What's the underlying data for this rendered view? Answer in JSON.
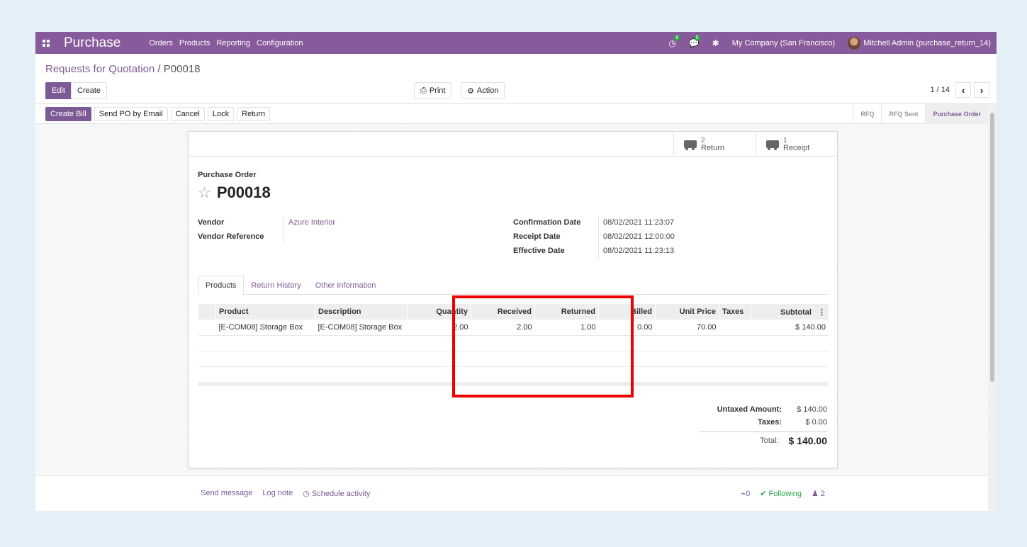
{
  "navbar": {
    "brand": "Purchase",
    "menu": [
      "Orders",
      "Products",
      "Reporting",
      "Configuration"
    ],
    "activity_count": "8",
    "messages_count": "5",
    "company": "My Company (San Francisco)",
    "user": "Mitchell Admin (purchase_return_14)"
  },
  "breadcrumb": {
    "parent": "Requests for Quotation",
    "separator": " / ",
    "current": "P00018"
  },
  "toolbar": {
    "edit": "Edit",
    "create": "Create",
    "print": "Print",
    "action": "Action"
  },
  "pager": {
    "value": "1 / 14"
  },
  "status_buttons": [
    "Create Bill",
    "Send PO by Email",
    "Cancel",
    "Lock",
    "Return"
  ],
  "stages": [
    "RFQ",
    "RFQ Sent",
    "Purchase Order"
  ],
  "active_stage": "Purchase Order",
  "smart_buttons": [
    {
      "count": "2",
      "label": "Return",
      "icon": "truck-icon"
    },
    {
      "count": "1",
      "label": "Receipt",
      "icon": "truck-icon"
    }
  ],
  "form": {
    "type_label": "Purchase Order",
    "name": "P00018",
    "vendor_label": "Vendor",
    "vendor": "Azure Interior",
    "vendor_ref_label": "Vendor Reference",
    "vendor_ref": "",
    "confirmation_label": "Confirmation Date",
    "confirmation": "08/02/2021 11:23:07",
    "receipt_label": "Receipt Date",
    "receipt": "08/02/2021 12:00:00",
    "effective_label": "Effective Date",
    "effective": "08/02/2021 11:23:13"
  },
  "tabs": [
    "Products",
    "Return History",
    "Other Information"
  ],
  "lines": {
    "columns": [
      "Product",
      "Description",
      "Quantity",
      "Received",
      "Returned",
      "Billed",
      "Unit Price",
      "Taxes",
      "Subtotal"
    ],
    "rows": [
      [
        "[E-COM08] Storage Box",
        "[E-COM08] Storage Box",
        "2.00",
        "2.00",
        "1.00",
        "0.00",
        "70.00",
        "",
        "$ 140.00"
      ]
    ]
  },
  "totals": {
    "untaxed_label": "Untaxed Amount:",
    "untaxed": "$ 140.00",
    "taxes_label": "Taxes:",
    "taxes": "$ 0.00",
    "total_label": "Total:",
    "total": "$ 140.00"
  },
  "chatter": {
    "send_message": "Send message",
    "log_note": "Log note",
    "schedule": "Schedule activity",
    "attachments": "0",
    "following": "Following",
    "followers": "2"
  },
  "colors": {
    "brand": "#875a9b",
    "link": "#7c5a95",
    "highlight": "#e00000"
  }
}
